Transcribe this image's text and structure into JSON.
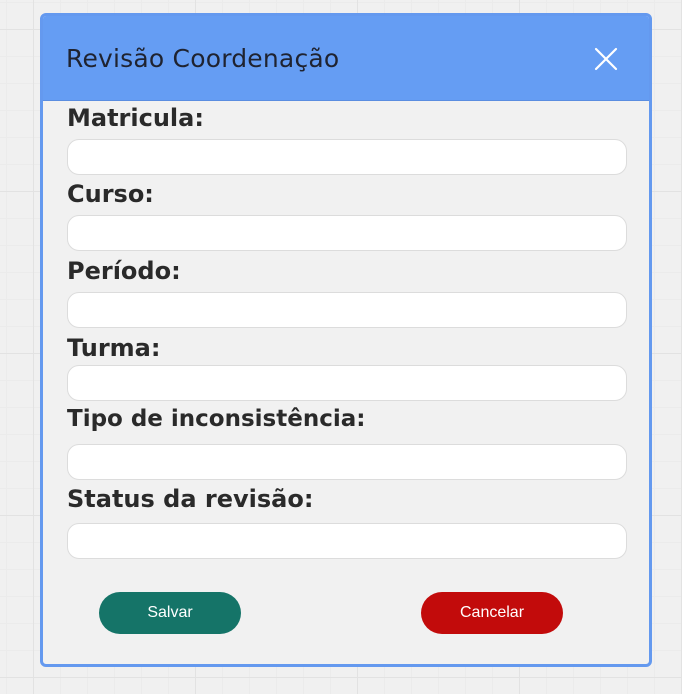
{
  "dialog": {
    "title": "Revisão Coordenação"
  },
  "form": {
    "fields": [
      {
        "label": "Matricula:",
        "value": ""
      },
      {
        "label": "Curso:",
        "value": ""
      },
      {
        "label": "Período:",
        "value": ""
      },
      {
        "label": "Turma:",
        "value": ""
      },
      {
        "label": "Tipo de inconsistência:",
        "value": ""
      },
      {
        "label": "Status da revisão:",
        "value": ""
      }
    ]
  },
  "actions": {
    "save_label": "Salvar",
    "cancel_label": "Cancelar"
  },
  "colors": {
    "header": "#659df3",
    "border": "#6499ef",
    "save": "#157468",
    "cancel": "#c20b0b"
  },
  "icons": {
    "close": "close-icon"
  }
}
